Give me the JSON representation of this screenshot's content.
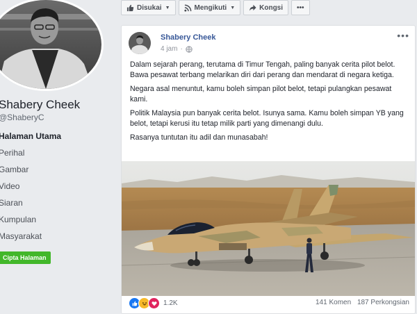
{
  "page": {
    "name": "Shabery Cheek",
    "handle": "@ShaberyC"
  },
  "sidebar": {
    "items": [
      {
        "label": "Halaman Utama",
        "active": true
      },
      {
        "label": "Perihal",
        "active": false
      },
      {
        "label": "Gambar",
        "active": false
      },
      {
        "label": "Video",
        "active": false
      },
      {
        "label": "Siaran",
        "active": false
      },
      {
        "label": "Kumpulan",
        "active": false
      },
      {
        "label": "Masyarakat",
        "active": false
      }
    ],
    "create_button": "Cipta Halaman"
  },
  "actions": {
    "liked": "Disukai",
    "following": "Mengikuti",
    "share": "Kongsi",
    "more": "•••"
  },
  "post": {
    "author": "Shabery Cheek",
    "time": "4 jam",
    "privacy_icon": "globe-icon",
    "more": "•••",
    "paragraphs": [
      "Dalam sejarah perang, terutama di Timur Tengah, paling banyak cerita pilot belot. Bawa pesawat terbang melarikan diri dari perang dan mendarat di negara ketiga.",
      "Negara asal menuntut, kamu boleh simpan pilot belot, tetapi pulangkan pesawat kami.",
      "Politik Malaysia pun banyak cerita belot. Isunya sama. Kamu boleh simpan YB yang belot, tetapi kerusi itu tetap milik parti yang dimenangi dulu.",
      "Rasanya tuntutan itu adil dan munasabah!"
    ],
    "reactions": {
      "types": [
        "like",
        "haha",
        "love"
      ],
      "count": "1.2K"
    },
    "comments": "141 Komen",
    "shares": "187 Perkongsian"
  },
  "colors": {
    "link": "#385898",
    "accent_green": "#42b72a",
    "like_blue": "#1877f2",
    "love_red": "#e0245e",
    "haha_yellow": "#f7b928"
  }
}
